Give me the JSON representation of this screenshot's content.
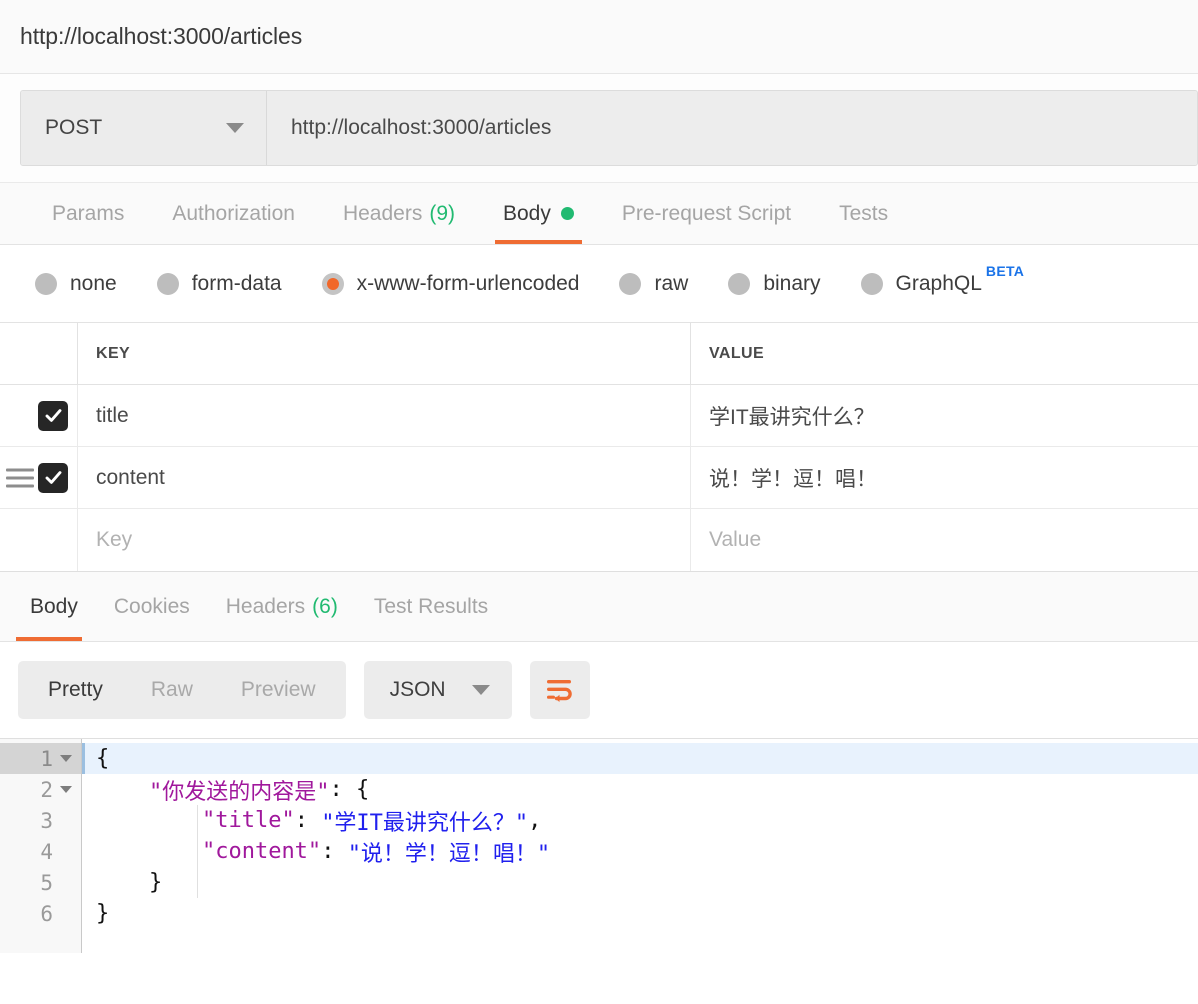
{
  "titlebar": {
    "title": "http://localhost:3000/articles"
  },
  "request": {
    "method": "POST",
    "url": "http://localhost:3000/articles",
    "tabs": [
      {
        "label": "Params",
        "active": false
      },
      {
        "label": "Authorization",
        "active": false
      },
      {
        "label": "Headers",
        "count": "(9)",
        "active": false
      },
      {
        "label": "Body",
        "dot": true,
        "active": true
      },
      {
        "label": "Pre-request Script",
        "active": false
      },
      {
        "label": "Tests",
        "active": false
      }
    ],
    "body_types": [
      {
        "label": "none",
        "selected": false
      },
      {
        "label": "form-data",
        "selected": false
      },
      {
        "label": "x-www-form-urlencoded",
        "selected": true
      },
      {
        "label": "raw",
        "selected": false
      },
      {
        "label": "binary",
        "selected": false
      },
      {
        "label": "GraphQL",
        "selected": false,
        "badge": "BETA"
      }
    ],
    "table": {
      "columns": {
        "key": "KEY",
        "value": "VALUE"
      },
      "rows": [
        {
          "checked": true,
          "key": "title",
          "value": "学IT最讲究什么？",
          "drag": false
        },
        {
          "checked": true,
          "key": "content",
          "value": "说！学！逗！唱！",
          "drag": true
        }
      ],
      "new_row": {
        "key_placeholder": "Key",
        "value_placeholder": "Value"
      }
    }
  },
  "response": {
    "tabs": [
      {
        "label": "Body",
        "active": true
      },
      {
        "label": "Cookies",
        "active": false
      },
      {
        "label": "Headers",
        "count": "(6)",
        "active": false
      },
      {
        "label": "Test Results",
        "active": false
      }
    ],
    "view_modes": [
      {
        "label": "Pretty",
        "active": true
      },
      {
        "label": "Raw",
        "active": false
      },
      {
        "label": "Preview",
        "active": false
      }
    ],
    "format": "JSON",
    "wrap_button": "wrap-text-icon",
    "code": {
      "lines": [
        {
          "number": "1",
          "fold": true,
          "active": true,
          "tokens": [
            {
              "t": "pun",
              "v": "{"
            }
          ]
        },
        {
          "number": "2",
          "fold": true,
          "active": false,
          "tokens": [
            {
              "t": "pun",
              "v": "    "
            },
            {
              "t": "key",
              "v": "\"你发送的内容是\""
            },
            {
              "t": "pun",
              "v": ": {"
            }
          ]
        },
        {
          "number": "3",
          "fold": false,
          "active": false,
          "tokens": [
            {
              "t": "pun",
              "v": "        "
            },
            {
              "t": "key",
              "v": "\"title\""
            },
            {
              "t": "pun",
              "v": ": "
            },
            {
              "t": "str",
              "v": "\"学IT最讲究什么？\""
            },
            {
              "t": "pun",
              "v": ","
            }
          ]
        },
        {
          "number": "4",
          "fold": false,
          "active": false,
          "tokens": [
            {
              "t": "pun",
              "v": "        "
            },
            {
              "t": "key",
              "v": "\"content\""
            },
            {
              "t": "pun",
              "v": ": "
            },
            {
              "t": "str",
              "v": "\"说！学！逗！唱！\""
            }
          ]
        },
        {
          "number": "5",
          "fold": false,
          "active": false,
          "tokens": [
            {
              "t": "pun",
              "v": "    }"
            }
          ]
        },
        {
          "number": "6",
          "fold": false,
          "active": false,
          "tokens": [
            {
              "t": "pun",
              "v": "}"
            }
          ]
        }
      ]
    }
  },
  "colors": {
    "accent_orange": "#ef6c33",
    "green": "#21ba71",
    "beta_blue": "#1a73e8",
    "json_key": "#a0189c",
    "json_string": "#2020ee"
  }
}
